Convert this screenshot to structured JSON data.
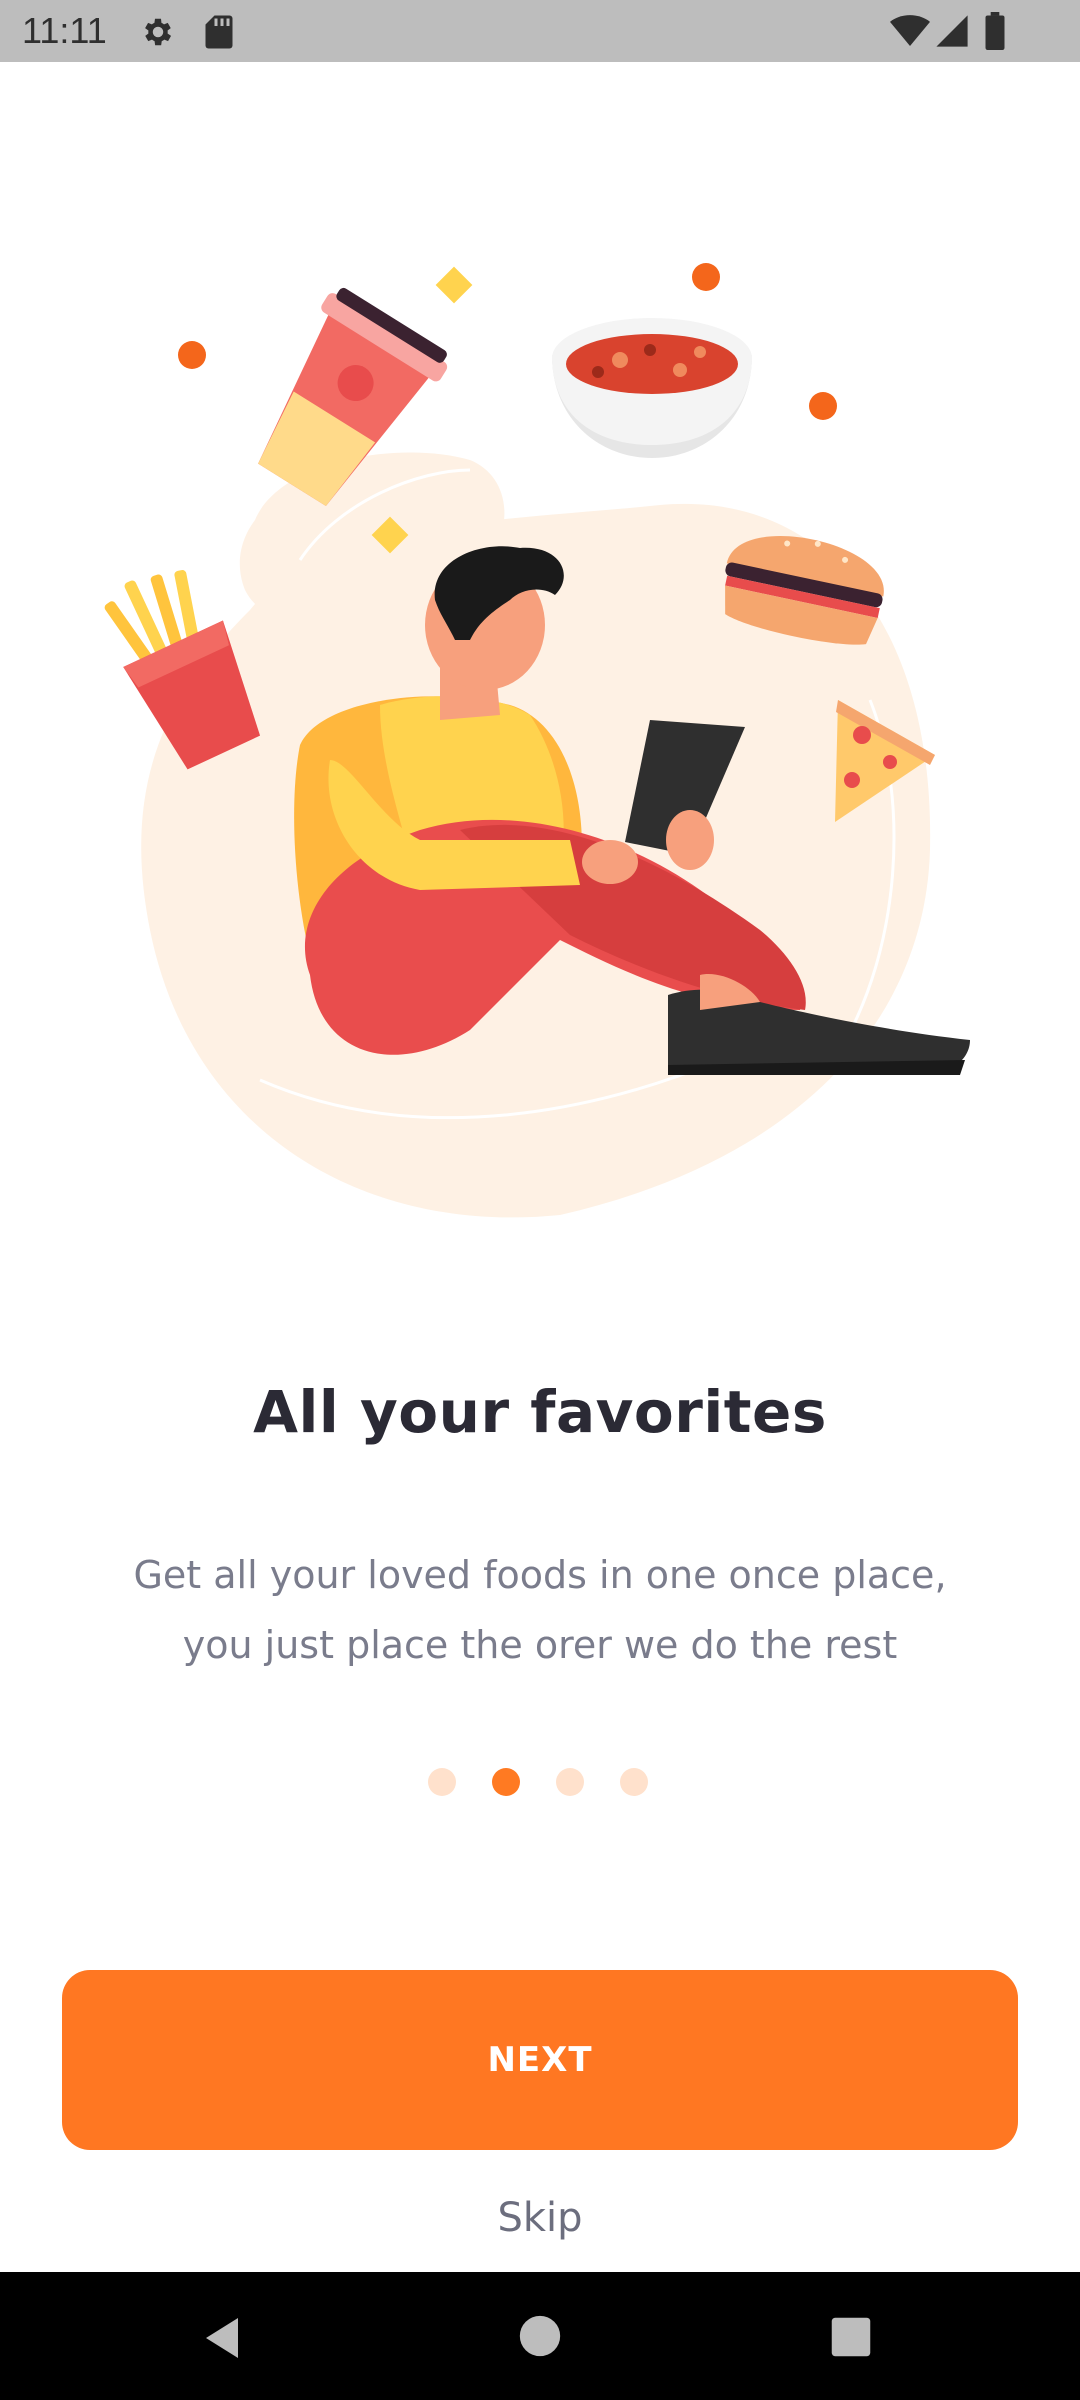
{
  "status_bar": {
    "time": "11:11",
    "icons": [
      "settings-icon",
      "sd-card-icon",
      "wifi-icon",
      "signal-icon",
      "battery-icon"
    ]
  },
  "onboarding": {
    "title": "All your favorites",
    "subtitle_line1": "Get all your loved foods in one once place,",
    "subtitle_line2": "you just place the orer we do the rest",
    "page_indicator": {
      "total_pages": 4,
      "current_page": 2
    },
    "next_label": "NEXT",
    "skip_label": "Skip"
  },
  "navigation_bar": {
    "icons": [
      "back-icon",
      "home-icon",
      "recents-icon"
    ]
  },
  "colors": {
    "accent": "#FF7722",
    "dot_inactive": "#FFE1CC",
    "title": "#2B2A35",
    "subtitle": "#7A7C8C",
    "blob": "#FEF1E4"
  }
}
